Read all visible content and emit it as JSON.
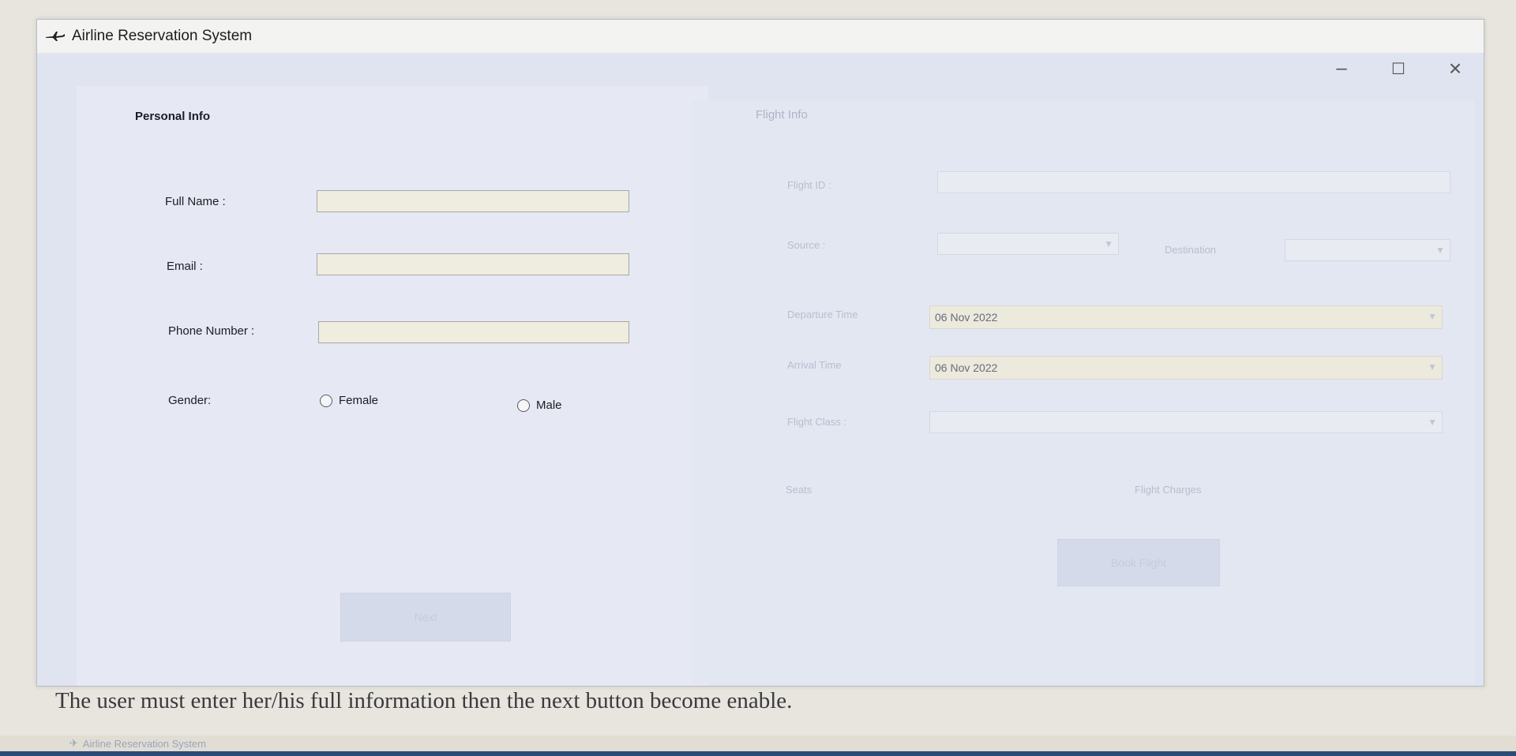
{
  "window": {
    "title": "Airline Reservation System",
    "controls": {
      "minimize": "–",
      "maximize": "☐",
      "close": "×"
    }
  },
  "personal_info": {
    "title": "Personal Info",
    "full_name_label": "Full Name :",
    "full_name_value": "",
    "email_label": "Email :",
    "email_value": "",
    "phone_label": "Phone Number :",
    "phone_value": "",
    "gender_label": "Gender:",
    "gender_options": [
      "Female",
      "Male"
    ]
  },
  "flight_info": {
    "title": "Flight Info",
    "flight_id_label": "Flight ID :",
    "source_label": "Source :",
    "destination_label": "Destination",
    "departure_label": "Departure Time",
    "departure_value": "06 Nov 2022",
    "arrival_label": "Arrival Time",
    "arrival_value": "06 Nov 2022",
    "flight_class_label": "Flight Class :",
    "seats_label": "Seats",
    "flight_charges_label": "Flight Charges"
  },
  "buttons": {
    "next_label": "Next",
    "book_label": "Book Flight"
  },
  "caption": "The user must enter her/his full information then the next button become enable.",
  "ghost_title": "Airline Reservation System",
  "colors": {
    "window_bg": "#eef0f4",
    "input_bg": "#efece0",
    "disabled_text": "#b8bdd0"
  }
}
